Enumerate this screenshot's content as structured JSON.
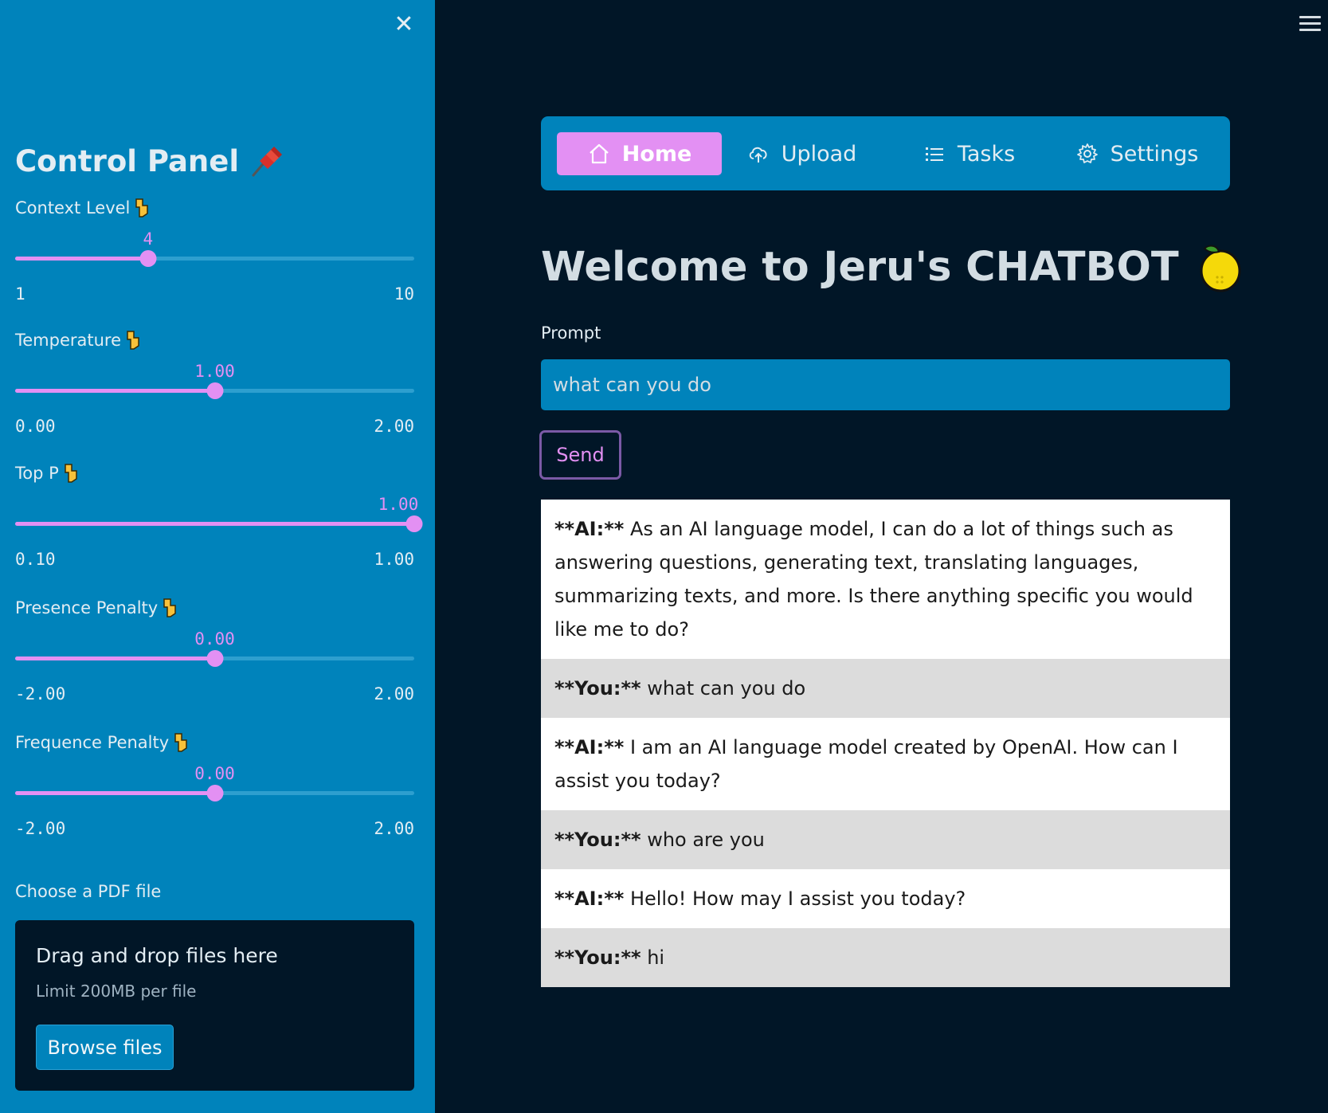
{
  "sidebar": {
    "title": "Control Panel",
    "sliders": [
      {
        "label": "Context Level",
        "value": "4",
        "min": "1",
        "max": "10",
        "fraction": 0.333
      },
      {
        "label": "Temperature",
        "value": "1.00",
        "min": "0.00",
        "max": "2.00",
        "fraction": 0.5
      },
      {
        "label": "Top P",
        "value": "1.00",
        "min": "0.10",
        "max": "1.00",
        "fraction": 1.0
      },
      {
        "label": "Presence Penalty",
        "value": "0.00",
        "min": "-2.00",
        "max": "2.00",
        "fraction": 0.5
      },
      {
        "label": "Frequence Penalty",
        "value": "0.00",
        "min": "-2.00",
        "max": "2.00",
        "fraction": 0.5
      }
    ],
    "upload": {
      "label": "Choose a PDF file",
      "drop_text": "Drag and drop files here",
      "limit_text": "Limit 200MB per file",
      "browse_label": "Browse files"
    }
  },
  "nav": {
    "items": [
      {
        "label": "Home",
        "icon": "home-icon",
        "active": true
      },
      {
        "label": "Upload",
        "icon": "cloud-upload-icon",
        "active": false
      },
      {
        "label": "Tasks",
        "icon": "list-icon",
        "active": false
      },
      {
        "label": "Settings",
        "icon": "gear-icon",
        "active": false
      }
    ]
  },
  "main": {
    "title": "Welcome to Jeru's CHATBOT",
    "prompt_label": "Prompt",
    "prompt_value": "what can you do",
    "send_label": "Send"
  },
  "chat": {
    "messages": [
      {
        "role": "ai",
        "prefix": "**AI:**",
        "text": " As an AI language model, I can do a lot of things such as answering questions, generating text, translating languages, summarizing texts, and more. Is there anything specific you would like me to do?"
      },
      {
        "role": "you",
        "prefix": "**You:**",
        "text": " what can you do"
      },
      {
        "role": "ai",
        "prefix": "**AI:**",
        "text": " I am an AI language model created by OpenAI. How can I assist you today?"
      },
      {
        "role": "you",
        "prefix": "**You:**",
        "text": " who are you"
      },
      {
        "role": "ai",
        "prefix": "**AI:**",
        "text": " Hello! How may I assist you today?"
      },
      {
        "role": "you",
        "prefix": "**You:**",
        "text": " hi"
      }
    ]
  },
  "colors": {
    "sidebar_bg": "#0083bb",
    "main_bg": "#011627",
    "accent": "#e390f3"
  }
}
